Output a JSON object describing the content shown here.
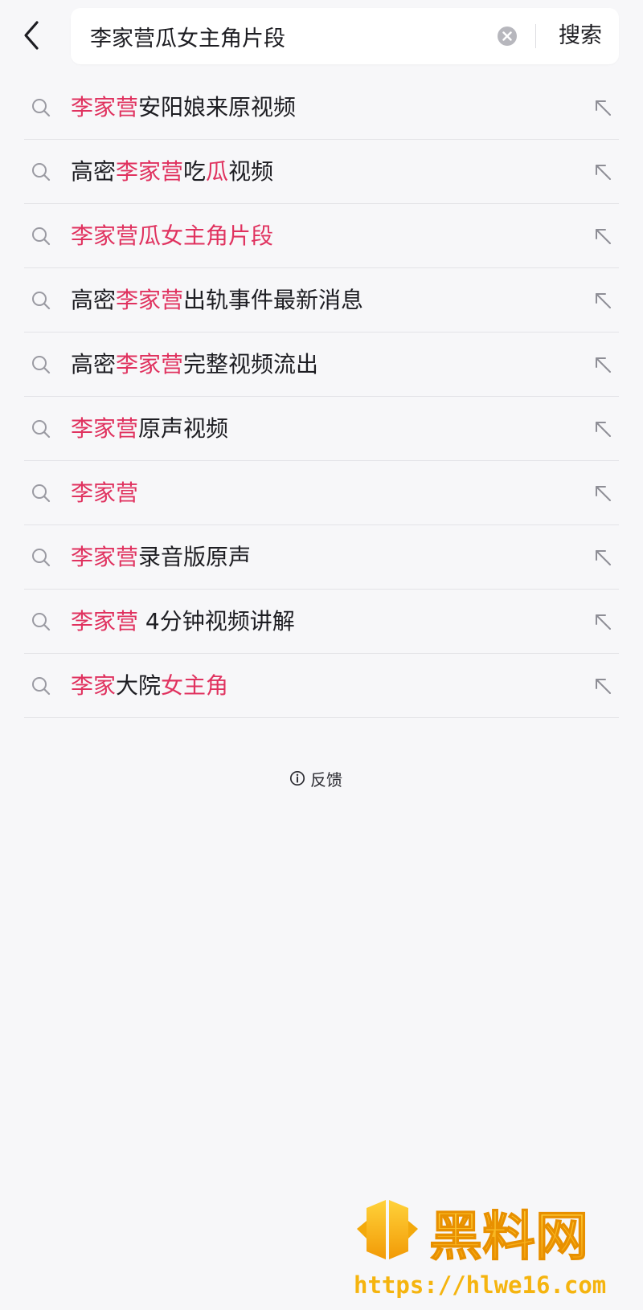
{
  "search": {
    "query": "李家营瓜女主角片段",
    "button_label": "搜索"
  },
  "suggestions": [
    {
      "parts": [
        {
          "t": "李家营",
          "h": true
        },
        {
          "t": "安阳娘来原视频",
          "h": false
        }
      ]
    },
    {
      "parts": [
        {
          "t": "高密",
          "h": false
        },
        {
          "t": "李家营",
          "h": true
        },
        {
          "t": "吃",
          "h": false
        },
        {
          "t": "瓜",
          "h": true
        },
        {
          "t": "视频",
          "h": false
        }
      ]
    },
    {
      "parts": [
        {
          "t": "李家营瓜女主角片段",
          "h": true
        }
      ]
    },
    {
      "parts": [
        {
          "t": "高密",
          "h": false
        },
        {
          "t": "李家营",
          "h": true
        },
        {
          "t": "出轨事件最新消息",
          "h": false
        }
      ]
    },
    {
      "parts": [
        {
          "t": "高密",
          "h": false
        },
        {
          "t": "李家营",
          "h": true
        },
        {
          "t": "完整视频流出",
          "h": false
        }
      ]
    },
    {
      "parts": [
        {
          "t": "李家营",
          "h": true
        },
        {
          "t": "原声视频",
          "h": false
        }
      ]
    },
    {
      "parts": [
        {
          "t": "李家营",
          "h": true
        }
      ]
    },
    {
      "parts": [
        {
          "t": "李家营",
          "h": true
        },
        {
          "t": "录音版原声",
          "h": false
        }
      ]
    },
    {
      "parts": [
        {
          "t": "李家营",
          "h": true
        },
        {
          "t": " 4分钟视频讲解",
          "h": false
        }
      ]
    },
    {
      "parts": [
        {
          "t": "李家",
          "h": true
        },
        {
          "t": "大院",
          "h": false
        },
        {
          "t": "女主角",
          "h": true
        }
      ]
    }
  ],
  "feedback": {
    "label": "反馈"
  },
  "watermark": {
    "title": "黑料网",
    "url": "https://hlwe16.com"
  },
  "colors": {
    "highlight": "#e0325f",
    "watermark": "#f5b40f"
  },
  "icons": {
    "back": "chevron-left-icon",
    "clear": "clear-circle-icon",
    "search": "magnifier-icon",
    "fill": "arrow-up-left-icon",
    "info": "info-circle-icon"
  }
}
